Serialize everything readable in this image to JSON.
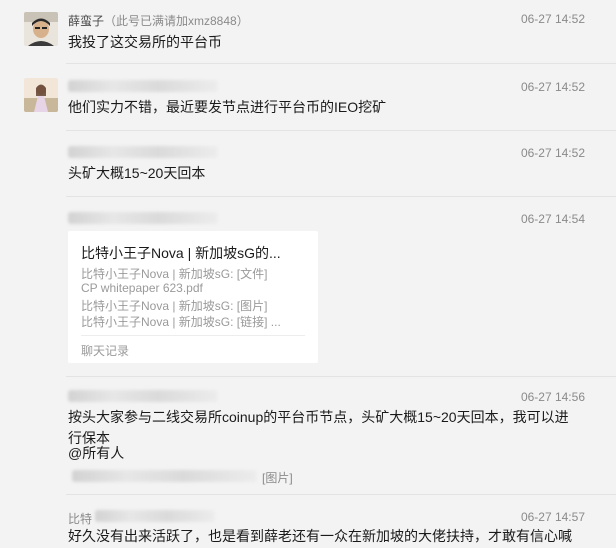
{
  "messages": [
    {
      "name": "薛蛮子",
      "note": "（此号已满请加xmz8848）",
      "time": "06-27 14:52",
      "text": "我投了这交易所的平台币"
    },
    {
      "time": "06-27 14:52",
      "text": "他们实力不错，最近要发节点进行平台币的IEO挖矿"
    },
    {
      "time": "06-27 14:52",
      "text": "头矿大概15~20天回本"
    },
    {
      "time": "06-27 14:54"
    },
    {
      "time": "06-27 14:56",
      "text_line1": "按头大家参与二线交易所coinup的平台币节点，头矿大概15~20天回本，我可以进",
      "text_line2": "行保本",
      "mention": "@所有人",
      "image_ref": "[图片]"
    },
    {
      "time": "06-27 14:57",
      "text": "好久没有出来活跃了，也是看到薛老还有一众在新加坡的大佬扶持，才敢有信心喊"
    }
  ],
  "card": {
    "title": "比特小王子Nova | 新加坡sG的...",
    "lines": [
      "比特小王子Nova | 新加坡sG: [文件]",
      "CP whitepaper 623.pdf",
      "比特小王子Nova | 新加坡sG: [图片]",
      "比特小王子Nova | 新加坡sG: [链接] ..."
    ],
    "footer": "聊天记录"
  },
  "partial_sender": "比特"
}
